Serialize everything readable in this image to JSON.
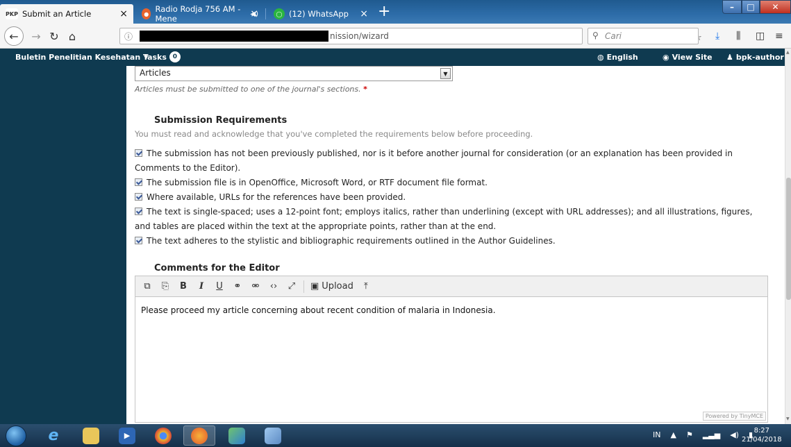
{
  "browser": {
    "tabs": [
      {
        "favicon": "PKP",
        "label": "Submit an Article",
        "active": true
      },
      {
        "favicon": "firefox-icon",
        "label": "Radio Rodja 756 AM - Mene",
        "active": false
      },
      {
        "favicon": "whatsapp-icon",
        "label": "(12) WhatsApp",
        "active": false
      }
    ],
    "close_glyph": "×",
    "new_tab_glyph": "+",
    "url_visible": "nission/wizard",
    "search_placeholder": "Cari",
    "url_icons": [
      "···",
      "♥",
      "☆"
    ]
  },
  "header": {
    "site_name": "Buletin Penelitian Kesehatan",
    "tasks_label": "Tasks",
    "tasks_count": "0",
    "language": "English",
    "view_site": "View Site",
    "user": "bpk-author"
  },
  "form": {
    "section_value": "Articles",
    "section_hint": "Articles must be submitted to one of the journal's sections.",
    "required_mark": "*",
    "requirements_title": "Submission Requirements",
    "requirements_subtitle": "You must read and acknowledge that you've completed the requirements below before proceeding.",
    "requirements": [
      "The submission has not been previously published, nor is it before another journal for consideration (or an explanation has been provided in Comments to the Editor).",
      "The submission file is in OpenOffice, Microsoft Word, or RTF document file format.",
      "Where available, URLs for the references have been provided.",
      "The text is single-spaced; uses a 12-point font; employs italics, rather than underlining (except with URL addresses); and all illustrations, figures, and tables are placed within the text at the appropriate points, rather than at the end.",
      "The text adheres to the stylistic and bibliographic requirements outlined in the Author Guidelines."
    ],
    "comments_title": "Comments for the Editor",
    "editor_toolbar": {
      "bold": "B",
      "italic": "I",
      "underline": "U",
      "upload": "Upload"
    },
    "editor_content": "Please proceed my article concerning about recent condition of malaria in Indonesia.",
    "powered_by": "Powered by TinyMCE"
  },
  "taskbar": {
    "lang": "IN",
    "time": "8:27",
    "date": "21/04/2018"
  }
}
